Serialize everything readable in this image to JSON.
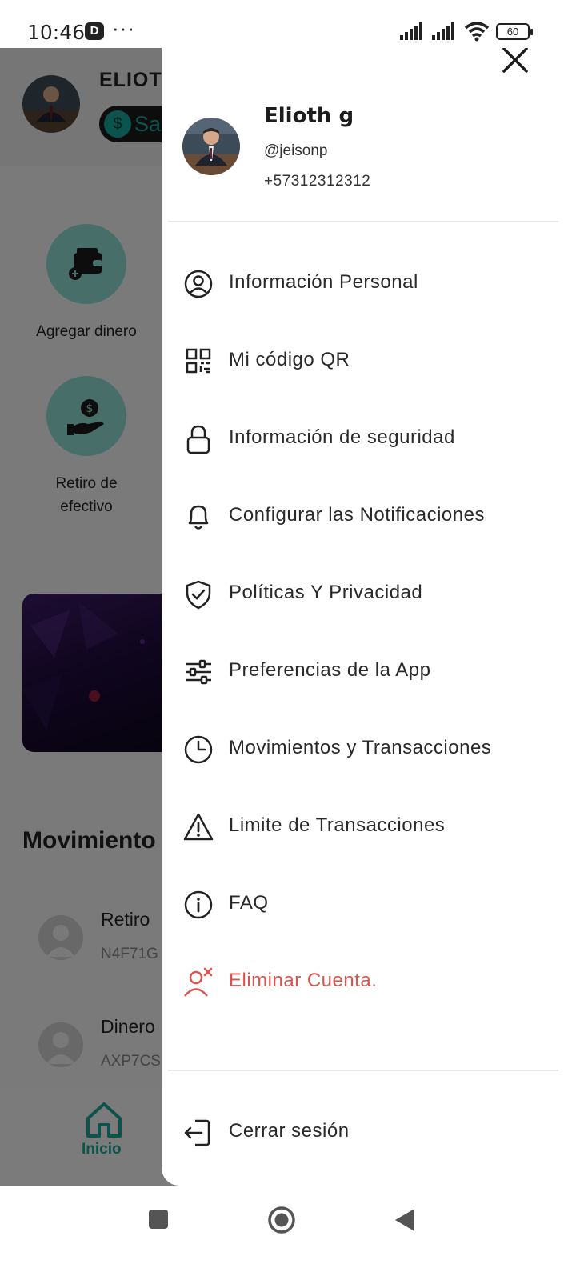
{
  "status_bar": {
    "time": "10:46",
    "app_indicator": "D",
    "more": "···",
    "battery": "60"
  },
  "background": {
    "user_name": "ELIOTH",
    "balance_prefix": "Sa",
    "coin_symbol": "$",
    "actions": [
      {
        "label": "Agregar dinero"
      },
      {
        "label": "Retiro de efectivo"
      }
    ],
    "movements_title": "Movimiento",
    "transactions": [
      {
        "title": "Retiro",
        "code": "N4F71G"
      },
      {
        "title": "Dinero",
        "code": "AXP7CS"
      }
    ],
    "nav_home_label": "Inicio"
  },
  "drawer": {
    "profile": {
      "name": "Elioth g",
      "username": "@jeisonp",
      "phone": "+57312312312"
    },
    "menu": [
      {
        "label": "Información Personal",
        "icon": "user-circle-icon"
      },
      {
        "label": "Mi código QR",
        "icon": "qr-code-icon"
      },
      {
        "label": "Información de seguridad",
        "icon": "lock-icon"
      },
      {
        "label": "Configurar las Notificaciones",
        "icon": "bell-icon"
      },
      {
        "label": "Políticas Y Privacidad",
        "icon": "shield-check-icon"
      },
      {
        "label": "Preferencias de la App",
        "icon": "sliders-icon"
      },
      {
        "label": "Movimientos y Transacciones",
        "icon": "clock-icon"
      },
      {
        "label": "Limite de Transacciones",
        "icon": "warning-icon"
      },
      {
        "label": "FAQ",
        "icon": "info-icon"
      },
      {
        "label": "Eliminar Cuenta.",
        "icon": "delete-user-icon"
      }
    ],
    "logout_label": "Cerrar sesión"
  },
  "colors": {
    "accent": "#1aa79a",
    "danger": "#d9534f",
    "scrim": "#000000"
  }
}
